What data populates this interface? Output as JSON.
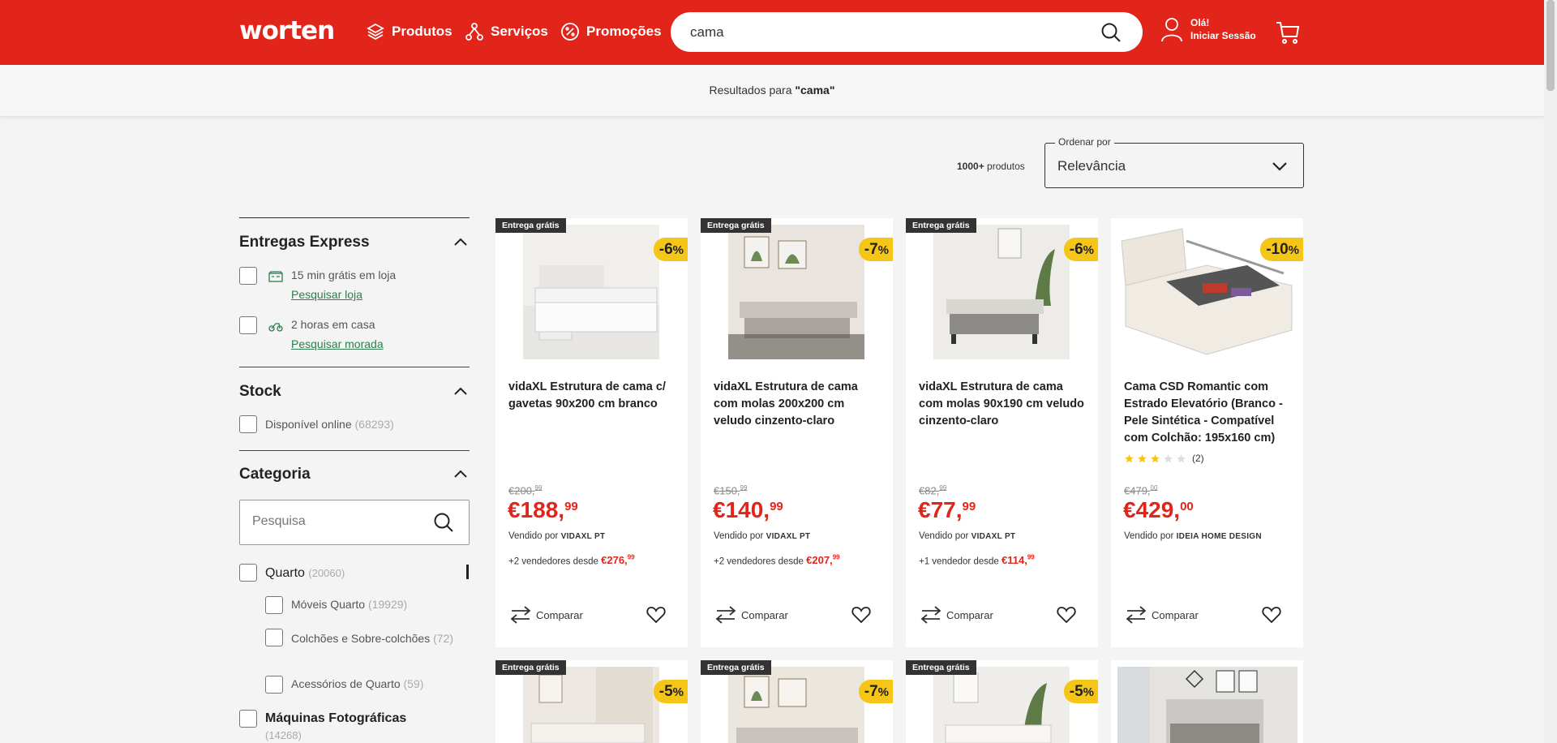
{
  "header": {
    "logo": "worten",
    "nav": {
      "produtos": "Produtos",
      "servicos": "Serviços",
      "promocoes": "Promoções"
    },
    "search_value": "cama",
    "account_line1": "Olá!",
    "account_line2": "Iniciar Sessão"
  },
  "results": {
    "prefix": "Resultados para",
    "query": "\"cama\""
  },
  "sort": {
    "count": "1000+",
    "count_suffix": "produtos",
    "label": "Ordenar por",
    "value": "Relevância"
  },
  "sidebar": {
    "express": {
      "title": "Entregas Express",
      "option1": "15 min grátis em loja",
      "option1_link": "Pesquisar loja",
      "option2": "2 horas em casa",
      "option2_link": "Pesquisar morada"
    },
    "stock": {
      "title": "Stock",
      "option": "Disponível online",
      "option_count": "(68293)"
    },
    "categoria": {
      "title": "Categoria",
      "search_placeholder": "Pesquisa",
      "items": [
        {
          "label": "Quarto",
          "count": "(20060)"
        },
        {
          "label": "Móveis Quarto",
          "count": "(19929)"
        },
        {
          "label": "Colchões e Sobre-colchões",
          "count": "(72)"
        },
        {
          "label": "Acessórios de Quarto",
          "count": "(59)"
        },
        {
          "label": "Máquinas Fotográficas",
          "count": "(14268)"
        }
      ]
    }
  },
  "products": [
    {
      "badge": "Entrega grátis",
      "discount": "-6",
      "title": "vidaXL Estrutura de cama c/ gavetas 90x200 cm branco",
      "old_price": "€200,",
      "old_cents": "99",
      "price": "€188,",
      "cents": "99",
      "sold_by_label": "Vendido por",
      "seller": "VIDAXL PT",
      "sellers_text": "+2 vendedores desde",
      "sellers_price": "€276,",
      "sellers_cents": "99",
      "compare": "Comparar"
    },
    {
      "badge": "Entrega grátis",
      "discount": "-7",
      "title": "vidaXL Estrutura de cama com molas 200x200 cm veludo cinzento-claro",
      "old_price": "€150,",
      "old_cents": "99",
      "price": "€140,",
      "cents": "99",
      "sold_by_label": "Vendido por",
      "seller": "VIDAXL PT",
      "sellers_text": "+2 vendedores desde",
      "sellers_price": "€207,",
      "sellers_cents": "99",
      "compare": "Comparar"
    },
    {
      "badge": "Entrega grátis",
      "discount": "-6",
      "title": "vidaXL Estrutura de cama com molas 90x190 cm veludo cinzento-claro",
      "old_price": "€82,",
      "old_cents": "99",
      "price": "€77,",
      "cents": "99",
      "sold_by_label": "Vendido por",
      "seller": "VIDAXL PT",
      "sellers_text": "+1 vendedor desde",
      "sellers_price": "€114,",
      "sellers_cents": "99",
      "compare": "Comparar"
    },
    {
      "discount": "-10",
      "title": "Cama CSD Romantic com Estrado Elevatório (Branco - Pele Sintética - Compatível com Colchão: 195x160 cm)",
      "rating": 3,
      "reviews": "(2)",
      "old_price": "€479,",
      "old_cents": "00",
      "price": "€429,",
      "cents": "00",
      "sold_by_label": "Vendido por",
      "seller": "IDEIA HOME DESIGN",
      "compare": "Comparar"
    }
  ],
  "products_row2": [
    {
      "badge": "Entrega grátis",
      "discount": "-5"
    },
    {
      "badge": "Entrega grátis",
      "discount": "-7"
    },
    {
      "badge": "Entrega grátis",
      "discount": "-5"
    },
    {}
  ],
  "percent_sign": "%",
  "colors": {
    "brand_red": "#e1251b",
    "discount_yellow": "#f5c518",
    "link_green": "#2e7d4f"
  }
}
